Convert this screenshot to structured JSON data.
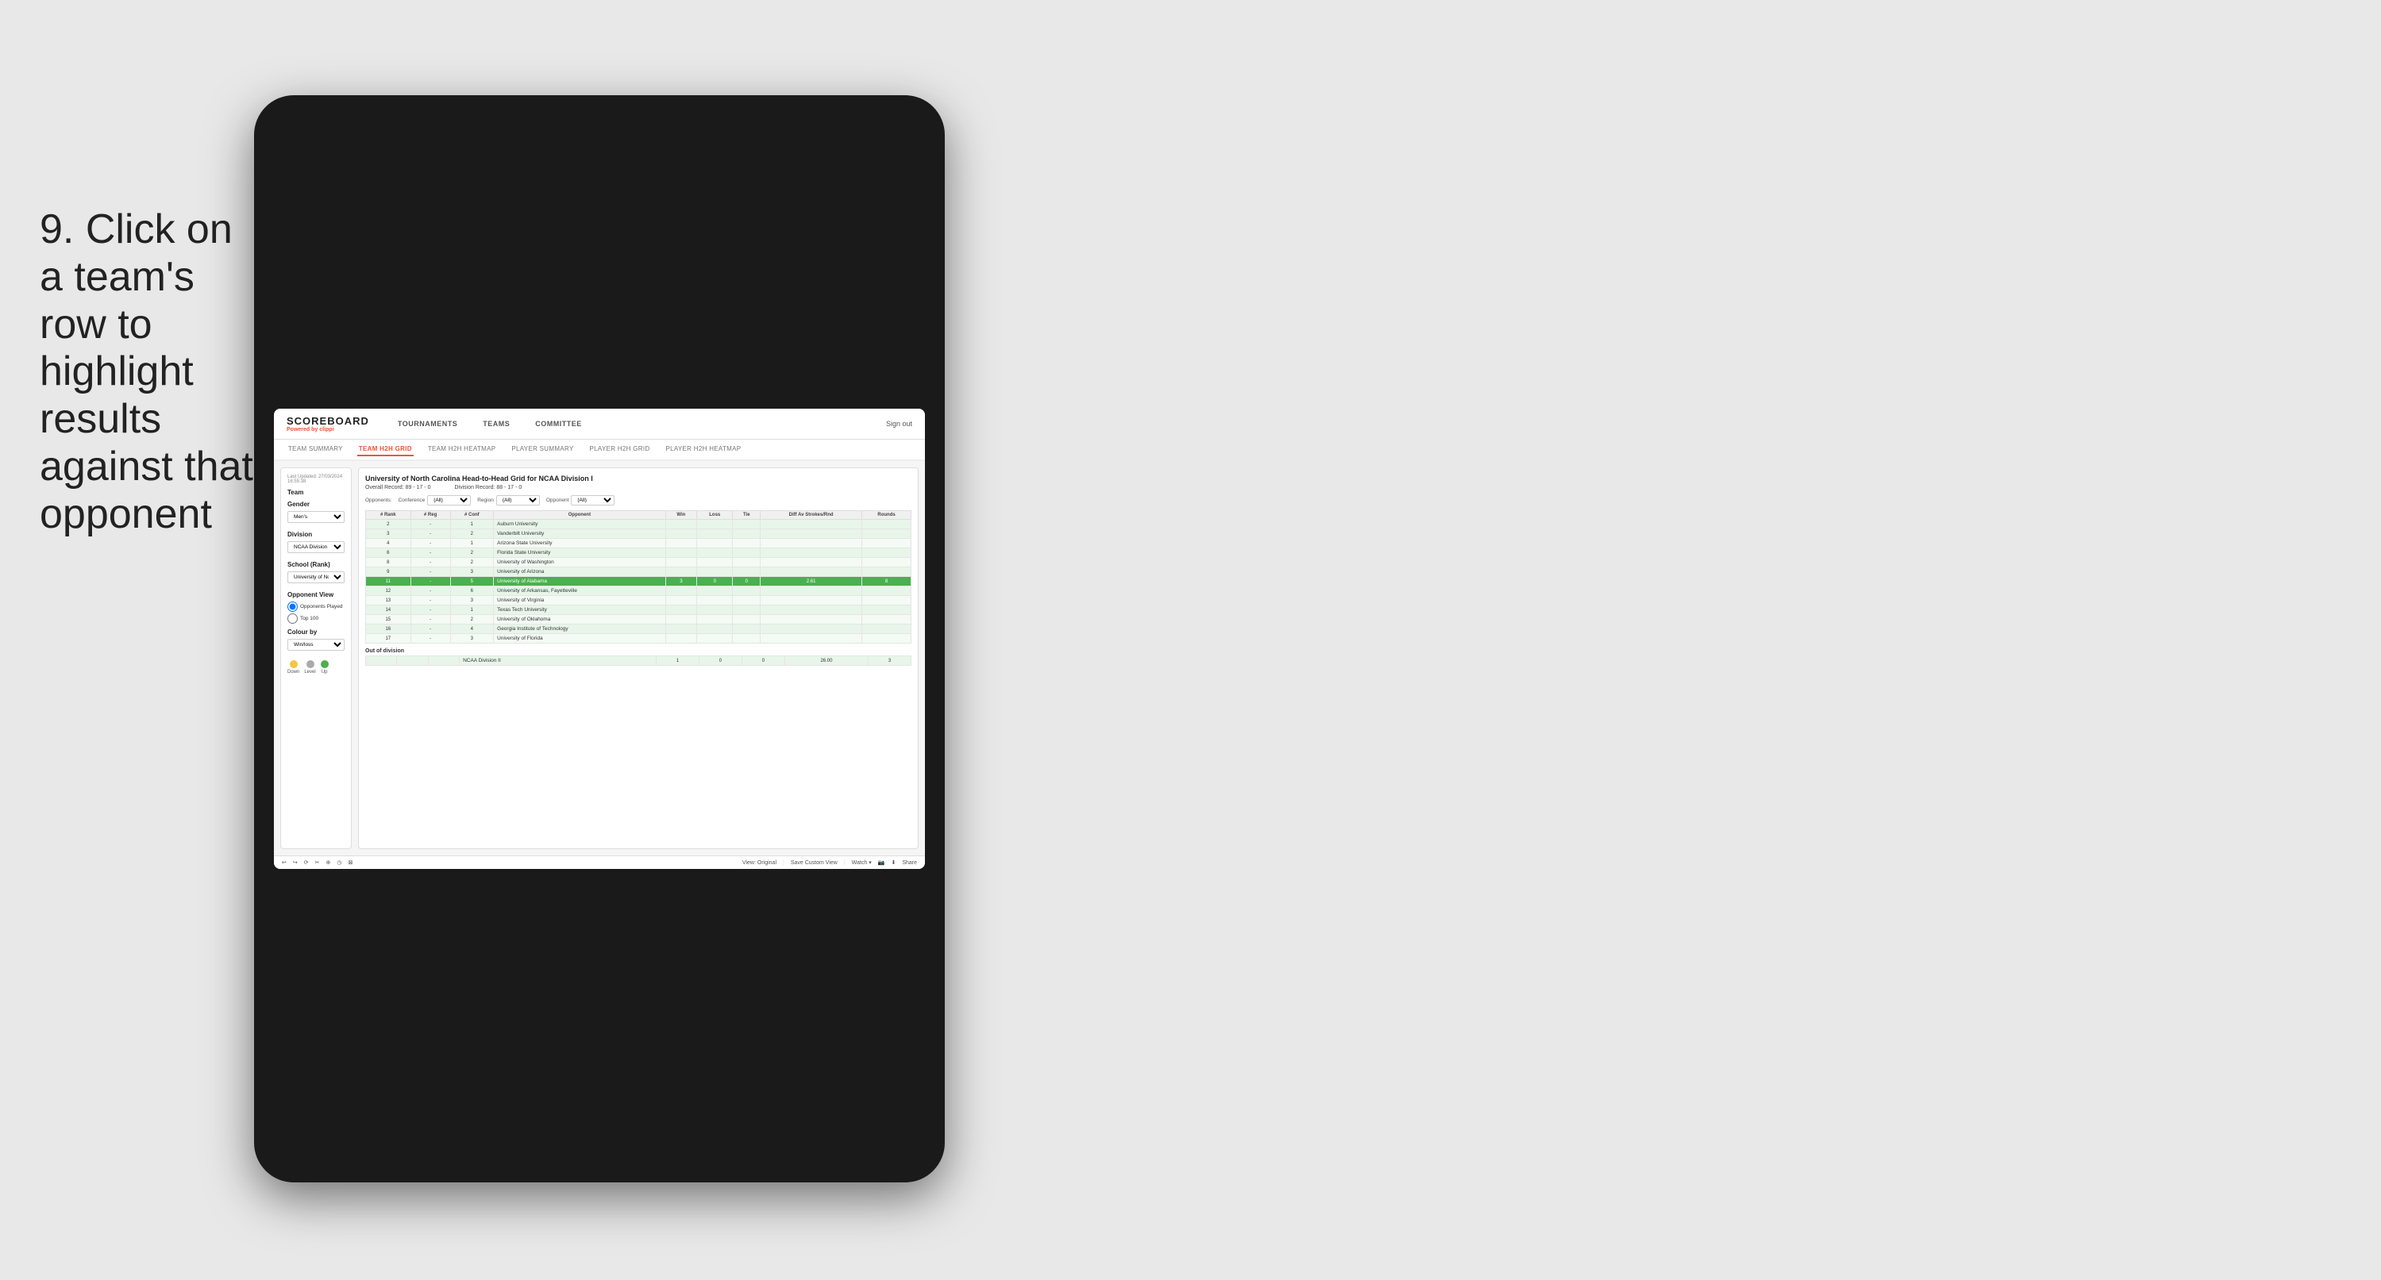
{
  "instruction": {
    "step": "9.",
    "text": "Click on a team's row to highlight results against that opponent"
  },
  "nav": {
    "logo": "SCOREBOARD",
    "logo_sub": "Powered by",
    "logo_brand": "clippi",
    "items": [
      "TOURNAMENTS",
      "TEAMS",
      "COMMITTEE"
    ],
    "sign_out": "Sign out"
  },
  "sub_nav": {
    "items": [
      "TEAM SUMMARY",
      "TEAM H2H GRID",
      "TEAM H2H HEATMAP",
      "PLAYER SUMMARY",
      "PLAYER H2H GRID",
      "PLAYER H2H HEATMAP"
    ],
    "active": "TEAM H2H GRID"
  },
  "sidebar": {
    "last_updated": "Last Updated: 27/03/2024",
    "time": "16:55:38",
    "team_label": "Team",
    "gender_label": "Gender",
    "gender_value": "Men's",
    "division_label": "Division",
    "division_value": "NCAA Division I",
    "school_label": "School (Rank)",
    "school_value": "University of Nort...",
    "opponent_view_label": "Opponent View",
    "radio_options": [
      "Opponents Played",
      "Top 100"
    ],
    "colour_label": "Colour by",
    "colour_value": "Win/loss",
    "legend": [
      {
        "label": "Down",
        "color": "#f5c542"
      },
      {
        "label": "Level",
        "color": "#aaa"
      },
      {
        "label": "Up",
        "color": "#4caf50"
      }
    ]
  },
  "table": {
    "title": "University of North Carolina Head-to-Head Grid for NCAA Division I",
    "overall_record": "Overall Record: 89 - 17 - 0",
    "division_record": "Division Record: 88 - 17 - 0",
    "filters": {
      "opponents_label": "Opponents:",
      "conference_label": "Conference",
      "conference_value": "(All)",
      "region_label": "Region",
      "region_value": "(All)",
      "opponent_label": "Opponent",
      "opponent_value": "(All)"
    },
    "columns": [
      "# Rank",
      "# Reg",
      "# Conf",
      "Opponent",
      "Win",
      "Loss",
      "Tie",
      "Diff Av Strokes/Rnd",
      "Rounds"
    ],
    "rows": [
      {
        "rank": "2",
        "reg": "-",
        "conf": "1",
        "opponent": "Auburn University",
        "win": "",
        "loss": "",
        "tie": "",
        "diff": "",
        "rounds": "",
        "style": "light"
      },
      {
        "rank": "3",
        "reg": "-",
        "conf": "2",
        "opponent": "Vanderbilt University",
        "win": "",
        "loss": "",
        "tie": "",
        "diff": "",
        "rounds": "",
        "style": "light"
      },
      {
        "rank": "4",
        "reg": "-",
        "conf": "1",
        "opponent": "Arizona State University",
        "win": "",
        "loss": "",
        "tie": "",
        "diff": "",
        "rounds": "",
        "style": "vlight"
      },
      {
        "rank": "6",
        "reg": "-",
        "conf": "2",
        "opponent": "Florida State University",
        "win": "",
        "loss": "",
        "tie": "",
        "diff": "",
        "rounds": "",
        "style": "light"
      },
      {
        "rank": "8",
        "reg": "-",
        "conf": "2",
        "opponent": "University of Washington",
        "win": "",
        "loss": "",
        "tie": "",
        "diff": "",
        "rounds": "",
        "style": "vlight"
      },
      {
        "rank": "9",
        "reg": "-",
        "conf": "3",
        "opponent": "University of Arizona",
        "win": "",
        "loss": "",
        "tie": "",
        "diff": "",
        "rounds": "",
        "style": "light"
      },
      {
        "rank": "11",
        "reg": "-",
        "conf": "5",
        "opponent": "University of Alabama",
        "win": "3",
        "loss": "0",
        "tie": "0",
        "diff": "2.61",
        "rounds": "8",
        "style": "highlighted"
      },
      {
        "rank": "12",
        "reg": "-",
        "conf": "6",
        "opponent": "University of Arkansas, Fayetteville",
        "win": "",
        "loss": "",
        "tie": "",
        "diff": "",
        "rounds": "",
        "style": "light"
      },
      {
        "rank": "13",
        "reg": "-",
        "conf": "3",
        "opponent": "University of Virginia",
        "win": "",
        "loss": "",
        "tie": "",
        "diff": "",
        "rounds": "",
        "style": "vlight"
      },
      {
        "rank": "14",
        "reg": "-",
        "conf": "1",
        "opponent": "Texas Tech University",
        "win": "",
        "loss": "",
        "tie": "",
        "diff": "",
        "rounds": "",
        "style": "light"
      },
      {
        "rank": "15",
        "reg": "-",
        "conf": "2",
        "opponent": "University of Oklahoma",
        "win": "",
        "loss": "",
        "tie": "",
        "diff": "",
        "rounds": "",
        "style": "vlight"
      },
      {
        "rank": "16",
        "reg": "-",
        "conf": "4",
        "opponent": "Georgia Institute of Technology",
        "win": "",
        "loss": "",
        "tie": "",
        "diff": "",
        "rounds": "",
        "style": "light"
      },
      {
        "rank": "17",
        "reg": "-",
        "conf": "3",
        "opponent": "University of Florida",
        "win": "",
        "loss": "",
        "tie": "",
        "diff": "",
        "rounds": "",
        "style": "vlight"
      }
    ],
    "out_of_division_label": "Out of division",
    "out_of_division_row": {
      "label": "NCAA Division II",
      "win": "1",
      "loss": "0",
      "tie": "0",
      "diff": "26.00",
      "rounds": "3"
    }
  },
  "toolbar": {
    "buttons": [
      "↩",
      "↪",
      "⟳",
      "✂",
      "⊕",
      "◷",
      "⊠"
    ],
    "view_label": "View: Original",
    "save_label": "Save Custom View",
    "watch_label": "Watch ▾",
    "share_label": "Share"
  }
}
